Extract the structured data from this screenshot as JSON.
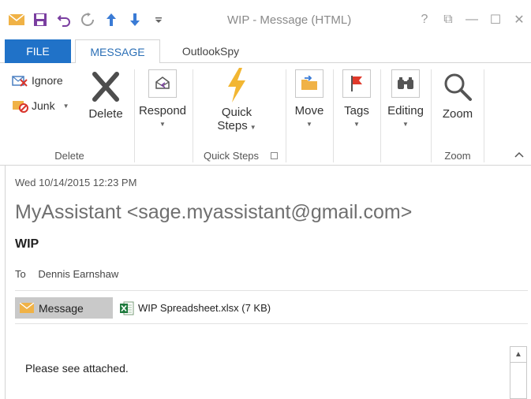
{
  "window": {
    "title": "WIP - Message (HTML)",
    "help_glyph": "?",
    "restore_glyph": "⧉",
    "minimize_glyph": "—",
    "maximize_glyph": "☐",
    "close_glyph": "✕"
  },
  "tabs": [
    {
      "label": "FILE"
    },
    {
      "label": "MESSAGE"
    },
    {
      "label": "OutlookSpy"
    }
  ],
  "ribbon": {
    "delete_group": {
      "ignore_label": "Ignore",
      "junk_label": "Junk",
      "delete_label": "Delete",
      "group_label": "Delete"
    },
    "respond_group": {
      "respond_label": "Respond"
    },
    "quicksteps_group": {
      "quick_label": "Quick",
      "steps_label": "Steps",
      "group_label": "Quick Steps"
    },
    "move_label": "Move",
    "tags_label": "Tags",
    "editing_label": "Editing",
    "zoom_group": {
      "zoom_label": "Zoom",
      "group_label": "Zoom"
    }
  },
  "message": {
    "date": "Wed 10/14/2015 12:23 PM",
    "from": "MyAssistant <sage.myassistant@gmail.com>",
    "subject": "WIP",
    "to_label": "To",
    "to_value": "Dennis Earnshaw",
    "message_tab_label": "Message",
    "attachment": "WIP Spreadsheet.xlsx (7 KB)",
    "body": "Please see attached."
  },
  "colors": {
    "file_tab": "#2072c8",
    "message_tab_text": "#2b6fb6",
    "envelope": "#f0b246",
    "save_purple": "#7a3ea0",
    "up_arrow": "#3a7bd5"
  }
}
